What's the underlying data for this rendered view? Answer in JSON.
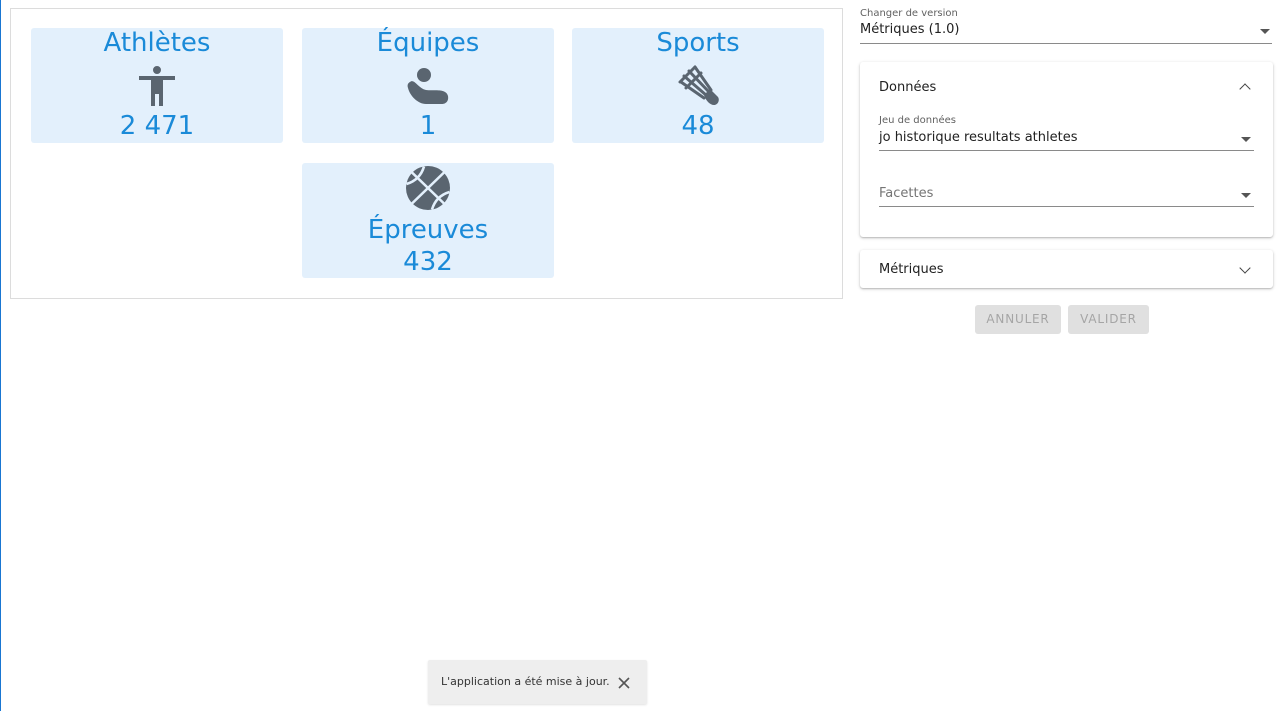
{
  "preview": {
    "cards": [
      {
        "title": "Athlètes",
        "value": "2 471",
        "icon": "person-icon"
      },
      {
        "title": "Équipes",
        "value": "1",
        "icon": "team-icon"
      },
      {
        "title": "Sports",
        "value": "48",
        "icon": "shuttlecock-icon"
      },
      {
        "title": "Épreuves",
        "value": "432",
        "icon": "basketball-icon"
      }
    ]
  },
  "version": {
    "label": "Changer de version",
    "value": "Métriques (1.0)"
  },
  "donnees_panel": {
    "title": "Données",
    "dataset_label": "Jeu de données",
    "dataset_value": "jo historique resultats athletes",
    "facets_placeholder": "Facettes"
  },
  "metriques_panel": {
    "title": "Métriques"
  },
  "actions": {
    "cancel_label": "ANNULER",
    "validate_label": "VALIDER"
  },
  "snackbar": {
    "message": "L'application a été mise à jour."
  },
  "colors": {
    "card_bg": "#e3f0fc",
    "card_text": "#1a8ad8",
    "icon": "#5a6570"
  }
}
